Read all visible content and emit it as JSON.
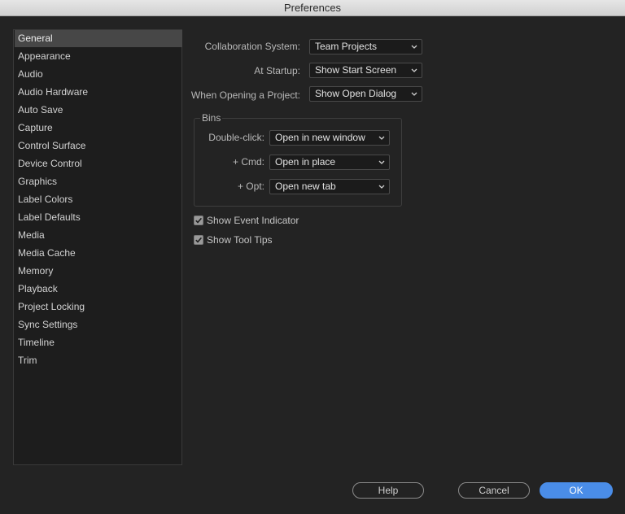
{
  "window": {
    "title": "Preferences"
  },
  "sidebar": {
    "selected": "General",
    "items": [
      "General",
      "Appearance",
      "Audio",
      "Audio Hardware",
      "Auto Save",
      "Capture",
      "Control Surface",
      "Device Control",
      "Graphics",
      "Label Colors",
      "Label Defaults",
      "Media",
      "Media Cache",
      "Memory",
      "Playback",
      "Project Locking",
      "Sync Settings",
      "Timeline",
      "Trim"
    ]
  },
  "general": {
    "collaboration": {
      "label": "Collaboration System:",
      "value": "Team Projects"
    },
    "startup": {
      "label": "At Startup:",
      "value": "Show Start Screen"
    },
    "opening": {
      "label": "When Opening a Project:",
      "value": "Show Open Dialog"
    }
  },
  "bins": {
    "title": "Bins",
    "double_click": {
      "label": "Double-click:",
      "value": "Open in new window"
    },
    "cmd": {
      "label": "+ Cmd:",
      "value": "Open in place"
    },
    "opt": {
      "label": "+ Opt:",
      "value": "Open new tab"
    }
  },
  "checkboxes": {
    "event_indicator": {
      "label": "Show Event Indicator",
      "checked": true
    },
    "tool_tips": {
      "label": "Show Tool Tips",
      "checked": true
    }
  },
  "buttons": {
    "help": "Help",
    "cancel": "Cancel",
    "ok": "OK"
  },
  "colors": {
    "accent": "#4a8de8",
    "background": "#232323",
    "selection": "#474747"
  },
  "icons": {
    "dropdown": "chevron-down-icon",
    "check": "checkmark-icon"
  }
}
